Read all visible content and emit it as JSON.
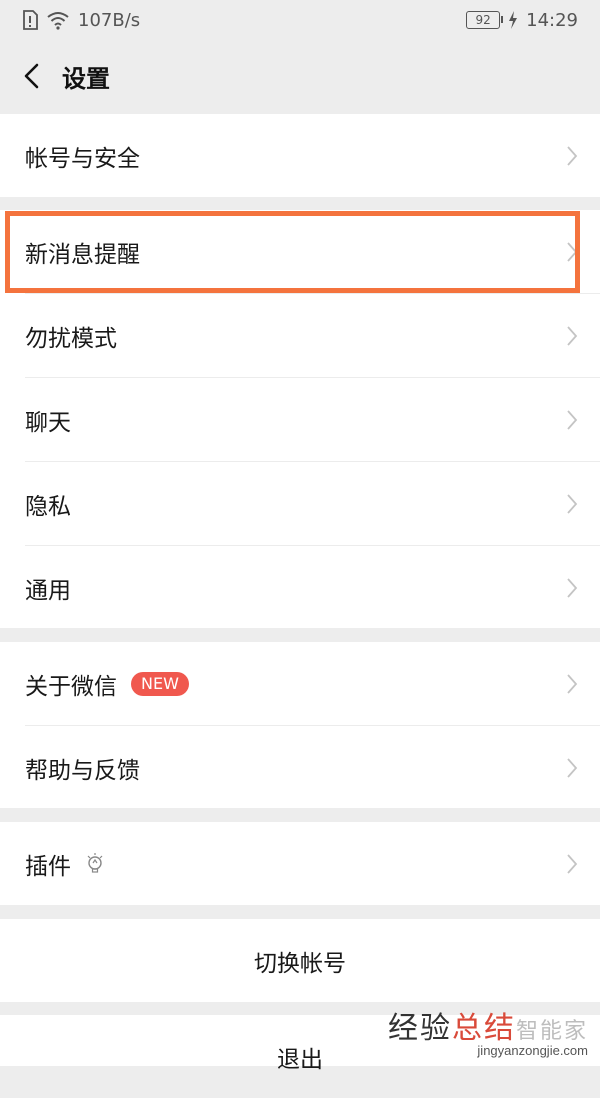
{
  "status_bar": {
    "network_speed": "107B/s",
    "battery": "92",
    "time": "14:29"
  },
  "nav": {
    "title": "设置"
  },
  "settings": {
    "account_security": "帐号与安全",
    "new_message_alerts": "新消息提醒",
    "do_not_disturb": "勿扰模式",
    "chat": "聊天",
    "privacy": "隐私",
    "general": "通用",
    "about_wechat": "关于微信",
    "new_badge": "NEW",
    "help_feedback": "帮助与反馈",
    "plugins": "插件",
    "switch_account": "切换帐号",
    "logout": "退出"
  },
  "watermark": {
    "brand_a": "经验",
    "brand_b": "总结",
    "brand_c": "智能家",
    "url": "jingyanzongjie.com"
  },
  "colors": {
    "highlight": "#f4733d",
    "badge": "#f0584e",
    "background": "#ededed"
  }
}
